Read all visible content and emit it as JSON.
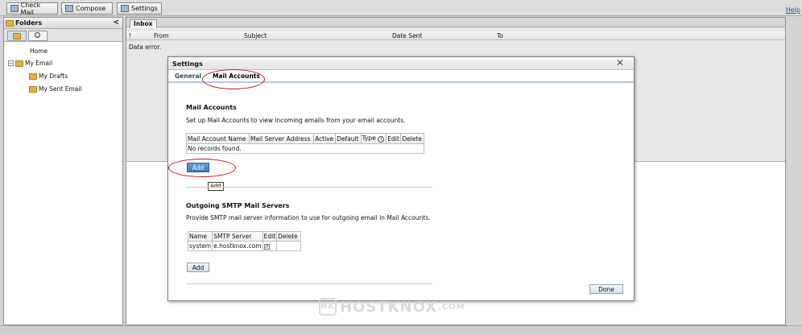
{
  "toolbar": {
    "check_mail": "Check Mail",
    "compose": "Compose",
    "settings": "Settings",
    "help": "Help"
  },
  "folders": {
    "title": "Folders",
    "collapse": "<",
    "items": {
      "home": "Home",
      "my_email": "My Email",
      "my_drafts": "My Drafts",
      "my_sent_email": "My Sent Email"
    }
  },
  "inbox": {
    "tab": "Inbox",
    "columns": {
      "flag": "!",
      "from": "From",
      "subject": "Subject",
      "date_sent": "Date Sent",
      "to": "To"
    },
    "message": "Data error."
  },
  "dialog": {
    "title": "Settings",
    "close": "✕",
    "tabs": {
      "general": "General",
      "mail_accounts": "Mail Accounts"
    },
    "mail_accounts": {
      "title": "Mail Accounts",
      "description": "Set up Mail Accounts to view incoming emails from your email accounts.",
      "columns": {
        "name": "Mail Account Name",
        "server": "Mail Server Address",
        "active": "Active",
        "default": "Default",
        "type": "Type",
        "edit": "Edit",
        "delete": "Delete"
      },
      "info_icon": "i",
      "empty": "No records found.",
      "add": "Add",
      "tooltip": "Add"
    },
    "smtp": {
      "title": "Outgoing SMTP Mail Servers",
      "description": "Provide SMTP mail server information to use for outgoing email in Mail Accounts.",
      "columns": {
        "name": "Name",
        "server": "SMTP Server",
        "edit": "Edit",
        "delete": "Delete"
      },
      "rows": [
        {
          "name": "system",
          "server": "e.hostknox.com",
          "edit": "↗"
        }
      ],
      "add": "Add"
    },
    "done": "Done"
  },
  "watermark": {
    "brand": "HOSTKNOX",
    "tld": ".COM",
    "logo": "HK"
  }
}
